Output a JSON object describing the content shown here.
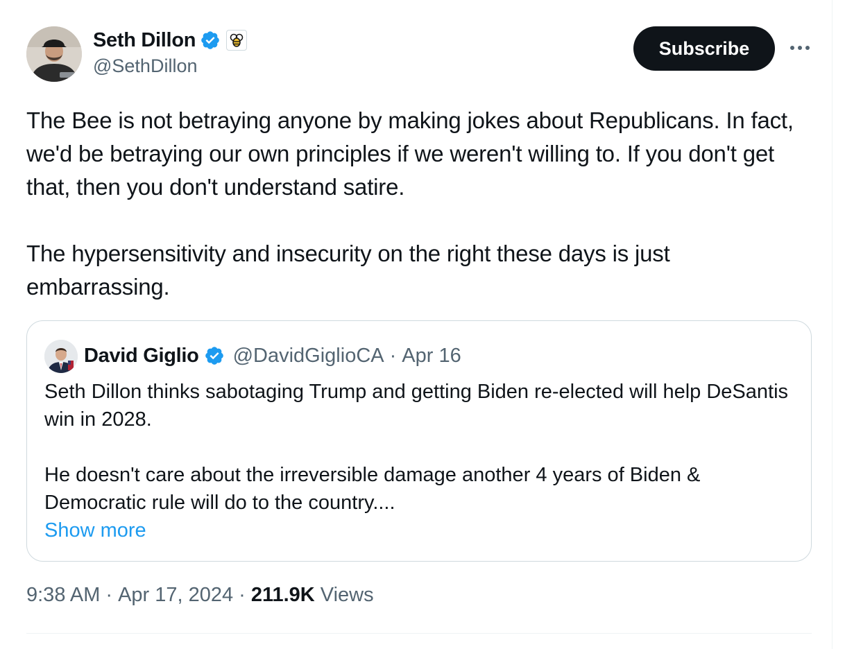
{
  "author": {
    "display_name": "Seth Dillon",
    "handle": "@SethDillon",
    "verified": true,
    "affiliate_badge": "babylon-bee-logo"
  },
  "actions": {
    "subscribe_label": "Subscribe",
    "more_icon": "more-horizontal-icon"
  },
  "tweet": {
    "paragraphs": [
      "The Bee is not betraying anyone by making jokes about Republicans. In fact, we'd be betraying our own principles if we weren't willing to. If you don't get that, then you don't understand satire.",
      "The hypersensitivity and insecurity on the right these days is just embarrassing."
    ]
  },
  "quote": {
    "display_name": "David Giglio",
    "handle": "@DavidGiglioCA",
    "separator": "·",
    "date": "Apr 16",
    "verified": true,
    "paragraphs": [
      "Seth Dillon thinks sabotaging Trump and getting Biden re-elected will help DeSantis win in 2028.",
      "He doesn't care about the irreversible damage another 4 years of Biden & Democratic rule will do to the country...."
    ],
    "show_more_label": "Show more"
  },
  "meta": {
    "time": "9:38 AM",
    "separator": "·",
    "date": "Apr 17, 2024",
    "views_count": "211.9K",
    "views_label": "Views"
  },
  "colors": {
    "text_primary": "#0f1419",
    "text_secondary": "#536471",
    "link": "#1d9bf0",
    "verified_badge": "#1d9bf0",
    "border": "#cfd9de",
    "subscribe_bg": "#0f1419"
  }
}
